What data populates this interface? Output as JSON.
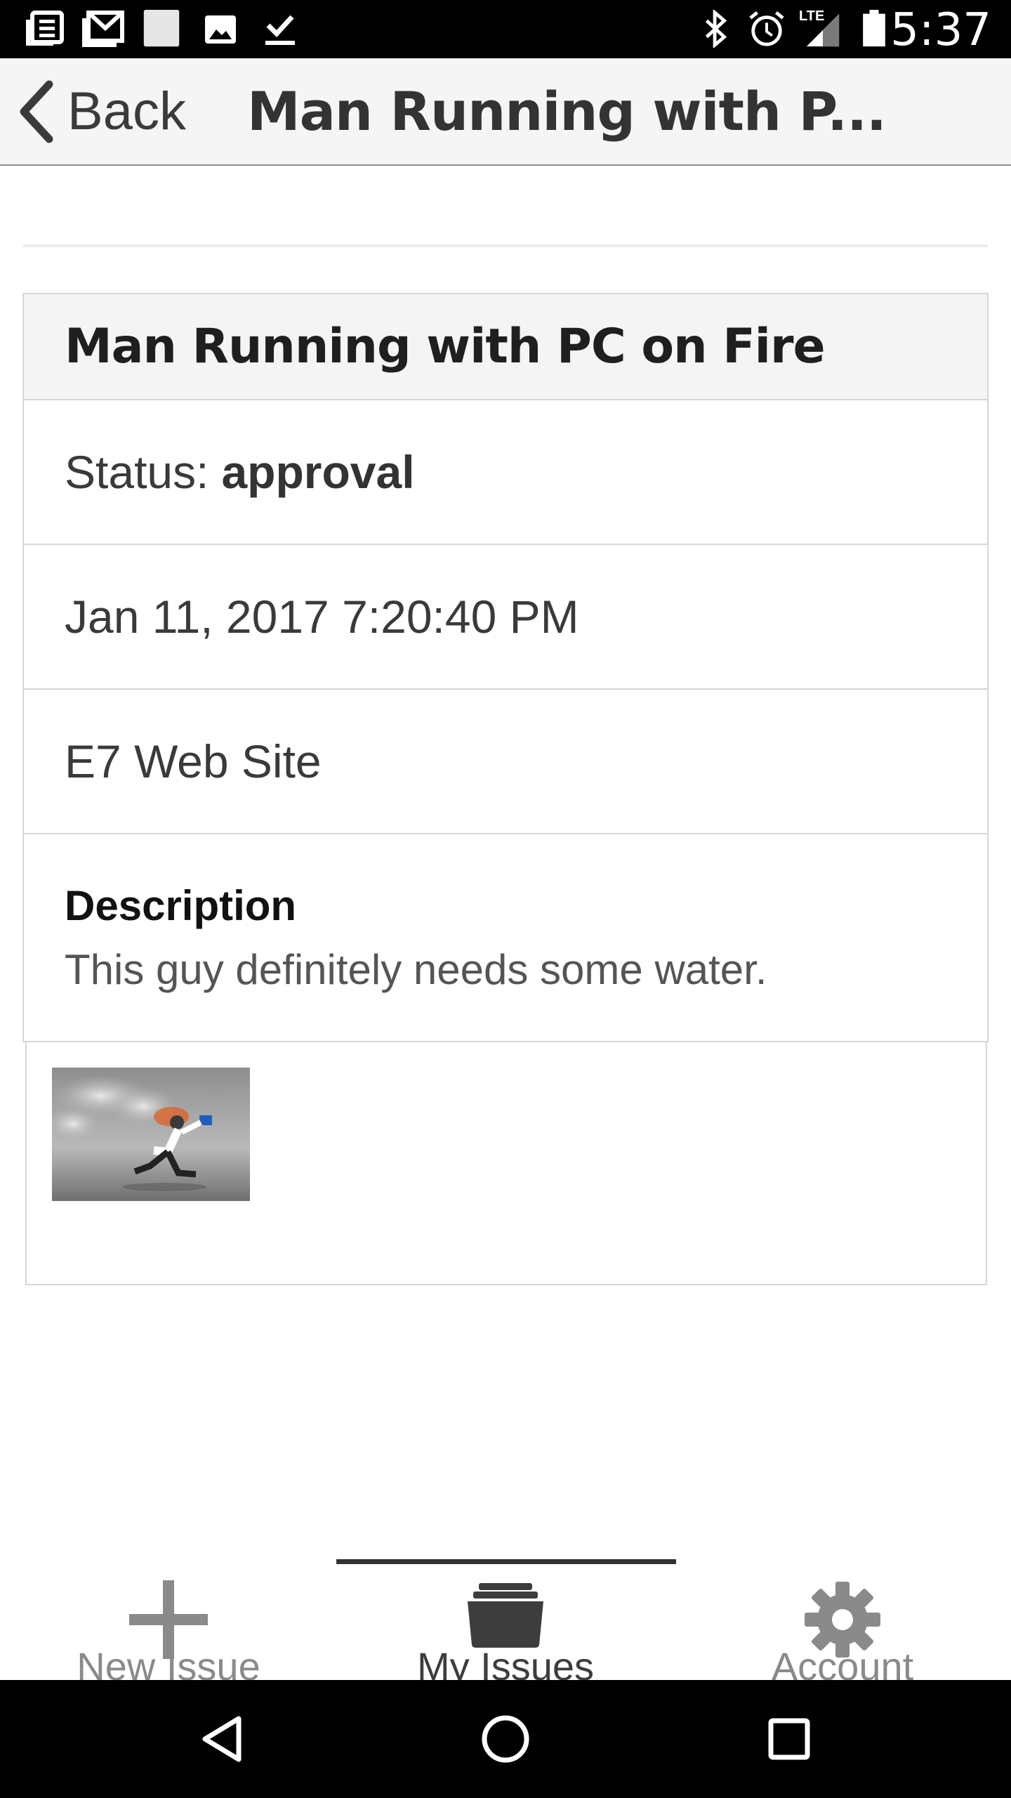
{
  "status_bar": {
    "clock": "5:37",
    "network": "LTE",
    "left_icons": [
      "news-icon",
      "gmail-icon",
      "blank-square-icon",
      "image-icon",
      "download-done-icon"
    ],
    "right_icons": [
      "bluetooth-icon",
      "alarm-icon",
      "signal-icon",
      "battery-icon"
    ]
  },
  "nav": {
    "back_label": "Back",
    "title": "Man Running with P..."
  },
  "issue": {
    "title": "Man Running with PC on Fire",
    "status_label": "Status:",
    "status_value": "approval",
    "date": "Jan 11, 2017 7:20:40 PM",
    "project": "E7 Web Site",
    "description_heading": "Description",
    "description": "This guy definitely needs some water."
  },
  "tabs": [
    {
      "label": "New Issue",
      "icon": "plus-icon",
      "active": false
    },
    {
      "label": "My Issues",
      "icon": "folder-icon",
      "active": true
    },
    {
      "label": "Account",
      "icon": "gear-icon",
      "active": false
    }
  ],
  "colors": {
    "status_bar_bg": "#000000",
    "nav_bg": "#f5f5f5",
    "card_border": "#d6d6d6",
    "active_tab": "#3d3d3d",
    "inactive_tab": "#8a8a8a"
  }
}
